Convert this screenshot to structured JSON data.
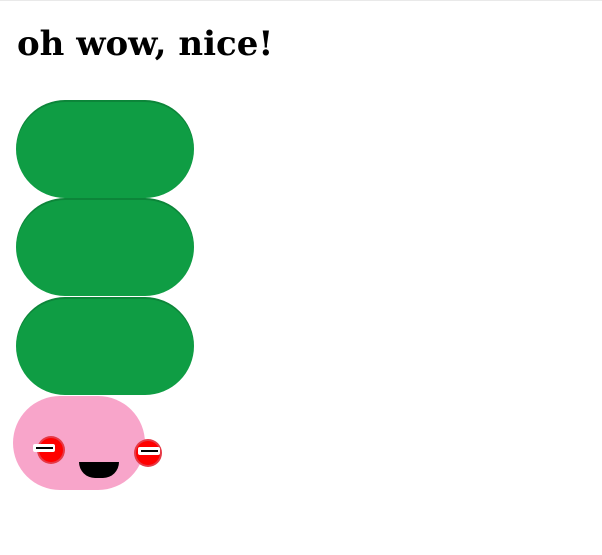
{
  "heading": "oh wow, nice!",
  "colors": {
    "segment": "#0f9d44",
    "head": "#f8a5ca",
    "eye": "#ff0000",
    "mouth": "#000000"
  },
  "parts": {
    "segments": 3,
    "eyes": 2
  }
}
